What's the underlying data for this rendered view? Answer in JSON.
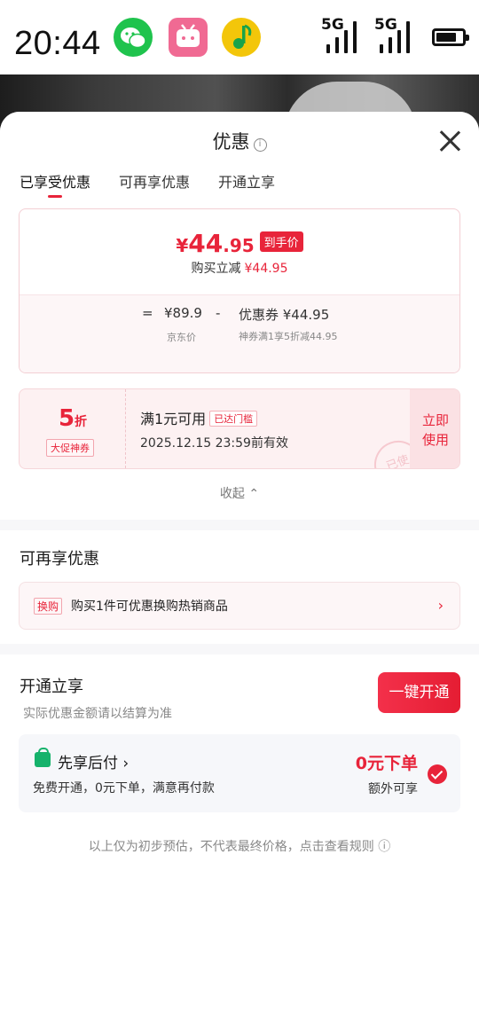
{
  "status_bar": {
    "time": "20:44",
    "apps": [
      "wechat-icon",
      "bilibili-icon",
      "qq-music-icon"
    ],
    "signal_1": "5G",
    "signal_2": "5G",
    "battery_level": 0.8
  },
  "sheet": {
    "title": "优惠",
    "info_glyph": "i"
  },
  "tabs": [
    {
      "label": "已享受优惠",
      "active": true
    },
    {
      "label": "可再享优惠",
      "active": false
    },
    {
      "label": "开通立享",
      "active": false
    }
  ],
  "price_card": {
    "final_price_symbol": "¥",
    "final_price_int": "44",
    "final_price_dec": ".95",
    "final_badge": "到手价",
    "discount_label": "购买立减",
    "discount_amount": "¥44.95",
    "calc_eq": "=",
    "original_price": "¥89.9",
    "original_label": "京东价",
    "calc_minus": "-",
    "coupon_amount": "优惠券 ¥44.95",
    "coupon_desc": "神券满1享5折减44.95"
  },
  "coupon": {
    "value": "5",
    "unit": "折",
    "tag": "大促神券",
    "condition": "满1元可用",
    "reached_badge": "已达门槛",
    "valid_until": "2025.12.15 23:59前有效",
    "use_label_1": "立即",
    "use_label_2": "使用",
    "stamp": "已使"
  },
  "collapse_label": "收起 ⌃",
  "section_more": {
    "title": "可再享优惠",
    "swap_tag": "换购",
    "swap_text": "购买1件可优惠换购热销商品",
    "arrow": "›"
  },
  "section_open": {
    "title": "开通立享",
    "subtitle": "实际优惠金额请以结算为准",
    "open_button": "一键开通",
    "pay_title": "先享后付 ›",
    "pay_desc": "免费开通，0元下单，满意再付款",
    "zero_order": "0元下单",
    "extra_enjoy": "额外可享"
  },
  "disclaimer": "以上仅为初步预估，不代表最终价格，点击查看规则 ⓘ",
  "colors": {
    "accent": "#e8243a",
    "green": "#15b26b"
  }
}
